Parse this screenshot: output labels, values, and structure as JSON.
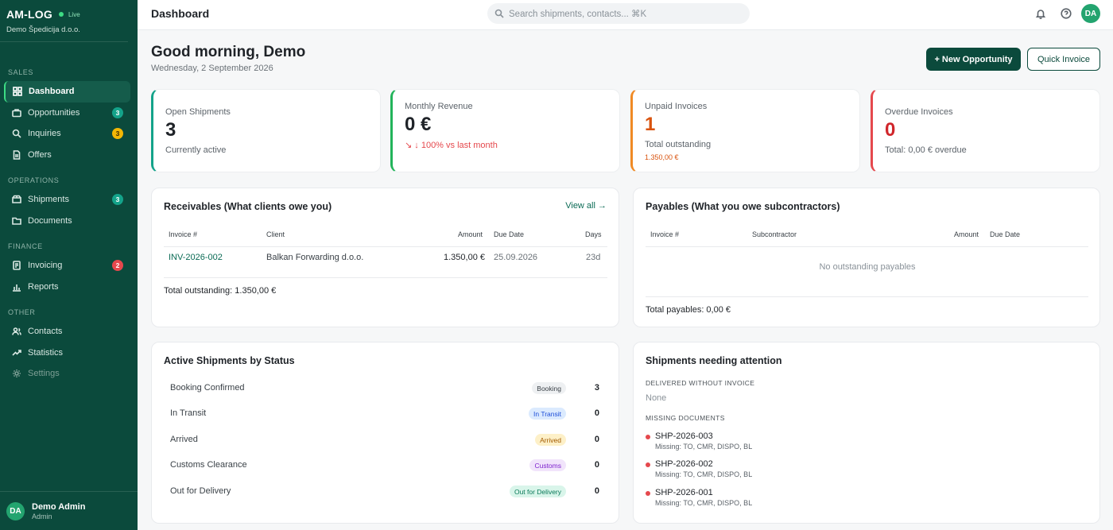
{
  "brand": {
    "name": "AM-LOG",
    "live": "Live",
    "company": "Demo Špedicija d.o.o."
  },
  "sidebar": {
    "sections": [
      {
        "label": "SALES",
        "items": [
          {
            "label": "Dashboard",
            "icon": "dashboard-icon",
            "active": true
          },
          {
            "label": "Opportunities",
            "icon": "briefcase-icon",
            "badge": "3"
          },
          {
            "label": "Inquiries",
            "icon": "search-icon",
            "badge": "3"
          },
          {
            "label": "Offers",
            "icon": "document-icon"
          }
        ]
      },
      {
        "label": "OPERATIONS",
        "items": [
          {
            "label": "Shipments",
            "icon": "truck-icon",
            "badge": "3"
          },
          {
            "label": "Documents",
            "icon": "folder-icon"
          }
        ]
      },
      {
        "label": "FINANCE",
        "items": [
          {
            "label": "Invoicing",
            "icon": "receipt-icon",
            "badge": "2"
          },
          {
            "label": "Reports",
            "icon": "bar-chart-icon"
          }
        ]
      },
      {
        "label": "OTHER",
        "items": [
          {
            "label": "Contacts",
            "icon": "contacts-icon"
          },
          {
            "label": "Statistics",
            "icon": "trend-icon"
          },
          {
            "label": "Settings",
            "icon": "gear-icon"
          }
        ]
      }
    ]
  },
  "user": {
    "initials": "DA",
    "name": "Demo Admin",
    "role": "Admin"
  },
  "topbar": {
    "title": "Dashboard",
    "search_placeholder": "Search shipments, contacts... ⌘K",
    "avatar": "DA"
  },
  "header": {
    "greeting": "Good morning, Demo",
    "date": "Wednesday, 2 September 2026",
    "new_opportunity": "+ New Opportunity",
    "quick_invoice": "Quick Invoice"
  },
  "stats": [
    {
      "label": "Open Shipments",
      "value": "3",
      "sub": "Currently active",
      "color": "#14a38a"
    },
    {
      "label": "Monthly Revenue",
      "value": "0 €",
      "sub": "↘ ↓ 100% vs last month",
      "color": "#22b45a"
    },
    {
      "label": "Unpaid Invoices",
      "value": "1",
      "sub": "Total outstanding",
      "sub2": "1.350,00 €",
      "color": "#f08a24"
    },
    {
      "label": "Overdue Invoices",
      "value": "0",
      "sub": "Total: 0,00 € overdue",
      "color": "#e5484d"
    }
  ],
  "receivables": {
    "title": "Receivables (What clients owe you)",
    "view_all": "View all →",
    "headers": {
      "invoice": "Invoice #",
      "client": "Client",
      "amount": "Amount",
      "due": "Due Date",
      "days": "Days"
    },
    "rows": [
      {
        "invoice": "INV-2026-002",
        "client": "Balkan Forwarding d.o.o.",
        "amount": "1.350,00 €",
        "due": "25.09.2026",
        "days": "23d"
      }
    ],
    "total": "Total outstanding: 1.350,00 €"
  },
  "payables": {
    "title": "Payables (What you owe subcontractors)",
    "headers": {
      "invoice": "Invoice #",
      "sub": "Subcontractor",
      "amount": "Amount",
      "due": "Due Date"
    },
    "empty": "No outstanding payables",
    "total": "Total payables: 0,00 €"
  },
  "status": {
    "title": "Active Shipments by Status",
    "rows": [
      {
        "name": "Booking Confirmed",
        "pill": "Booking",
        "count": "3",
        "bg": "#eef0f2",
        "fg": "#3a4147"
      },
      {
        "name": "In Transit",
        "pill": "In Transit",
        "count": "0",
        "bg": "#dbeafe",
        "fg": "#1d4ed8"
      },
      {
        "name": "Arrived",
        "pill": "Arrived",
        "count": "0",
        "bg": "#fdf0c8",
        "fg": "#a35b00"
      },
      {
        "name": "Customs Clearance",
        "pill": "Customs",
        "count": "0",
        "bg": "#f1e4fb",
        "fg": "#7e22ce"
      },
      {
        "name": "Out for Delivery",
        "pill": "Out for Delivery",
        "count": "0",
        "bg": "#d9f5ea",
        "fg": "#0b7a5a"
      }
    ]
  },
  "attention": {
    "title": "Shipments needing attention",
    "delivered_label": "DELIVERED WITHOUT INVOICE",
    "delivered_none": "None",
    "missing_label": "MISSING DOCUMENTS",
    "items": [
      {
        "id": "SHP-2026-003",
        "missing": "Missing: TO, CMR, DISPO, BL"
      },
      {
        "id": "SHP-2026-002",
        "missing": "Missing: TO, CMR, DISPO, BL"
      },
      {
        "id": "SHP-2026-001",
        "missing": "Missing: TO, CMR, DISPO, BL"
      }
    ]
  }
}
